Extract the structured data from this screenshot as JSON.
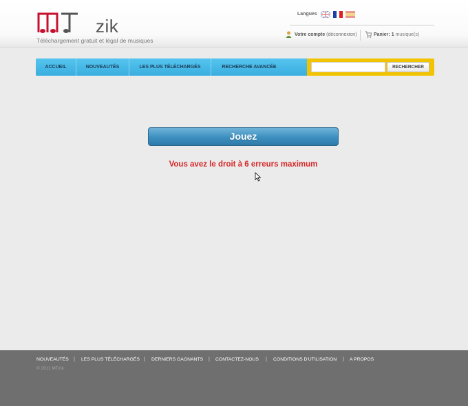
{
  "header": {
    "logo_text": "zik",
    "tagline": "Téléchargement gratuit et légal de musiques",
    "languages_label": "Langues",
    "account_label": "Votre compte",
    "logout_label": "(déconnexion)",
    "cart_label": "Panier:",
    "cart_count": "1",
    "cart_suffix": "musique(s)"
  },
  "nav": {
    "items": [
      {
        "label": "ACCUEIL"
      },
      {
        "label": "NOUVEAUTÉS"
      },
      {
        "label": "LES PLUS TÉLÉCHARGÉS"
      },
      {
        "label": "RECHERCHE AVANCÉE"
      }
    ],
    "search_value": "",
    "search_button": "RECHERCHER"
  },
  "main": {
    "play_button": "Jouez",
    "error_message": "Vous avez le droit à 6 erreurs maximum"
  },
  "footer": {
    "links": [
      {
        "label": "NOUVEAUTÉS"
      },
      {
        "label": "LES PLUS TÉLÉCHARGÉS"
      },
      {
        "label": "DERNIERS GAGNANTS"
      },
      {
        "label": "CONTACTEZ-NOUS"
      },
      {
        "label": "CONDITIONS D'UTILISATION"
      },
      {
        "label": "A PROPOS"
      }
    ],
    "copyright": "© 2011 MTzik"
  },
  "colors": {
    "brand_red": "#c8102e",
    "nav_blue": "#3aaee0",
    "nav_yellow": "#f2c300",
    "error_red": "#d62828"
  }
}
